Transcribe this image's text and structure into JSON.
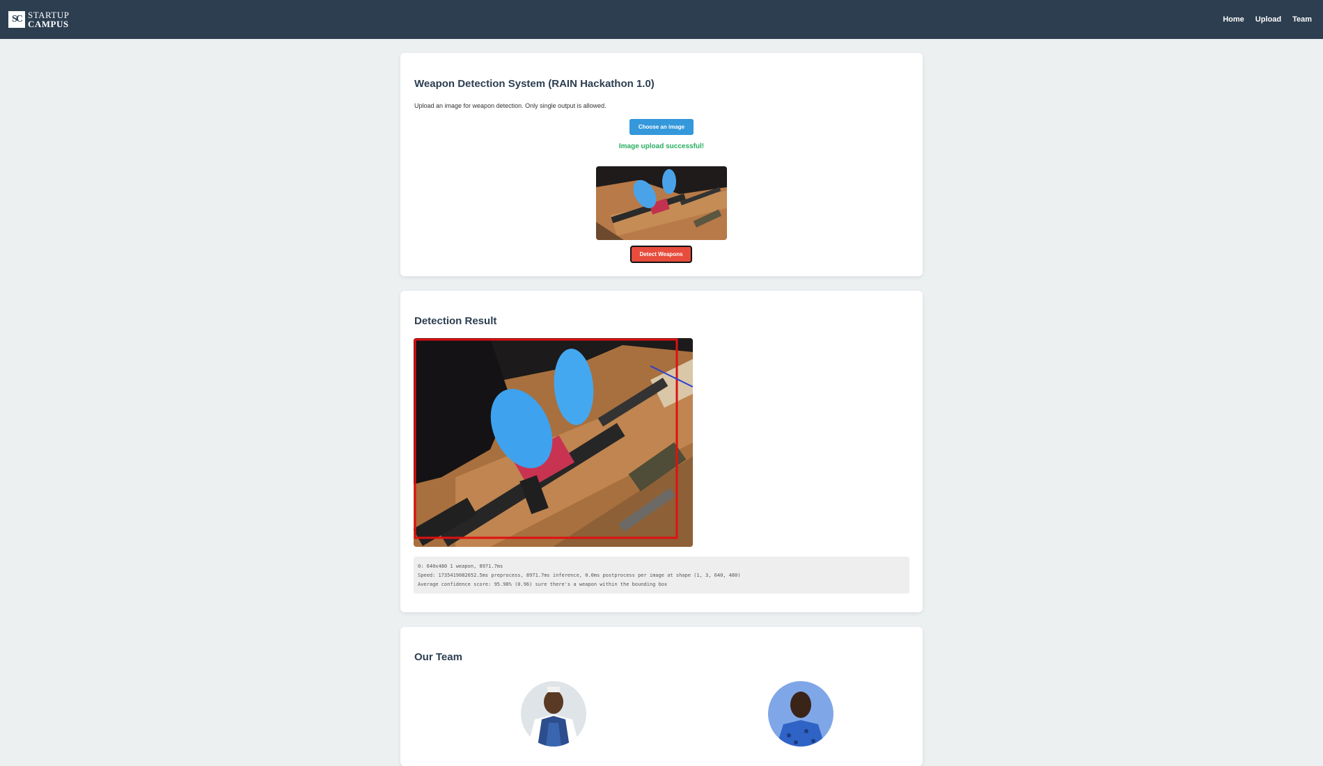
{
  "header": {
    "logo_mark": "SC",
    "logo_line1": "STARTUP",
    "logo_line2": "CAMPUS",
    "nav": {
      "home": "Home",
      "upload": "Upload",
      "team": "Team"
    }
  },
  "upload": {
    "title": "Weapon Detection System (RAIN Hackathon 1.0)",
    "intro": "Upload an image for weapon detection. Only single output is allowed.",
    "choose_label": "Choose an image",
    "status": "Image upload successful!",
    "detect_label": "Detect Weapons"
  },
  "result": {
    "title": "Detection Result",
    "log": [
      "0: 640x480 1 weapon, 8971.7ms",
      "Speed: 1735419082652.5ms preprocess, 8971.7ms inference, 0.0ms postprocess per image at shape (1, 3, 640, 480)",
      "Average confidence score: 95.98% (0.96) sure there's a weapon within the bounding box"
    ]
  },
  "team": {
    "title": "Our Team"
  },
  "colors": {
    "header_bg": "#2c3e50",
    "page_bg": "#ecf0f1",
    "primary_button": "#3498db",
    "danger_button": "#e74c3c",
    "success_text": "#27ae60",
    "bbox": "#e01010"
  }
}
